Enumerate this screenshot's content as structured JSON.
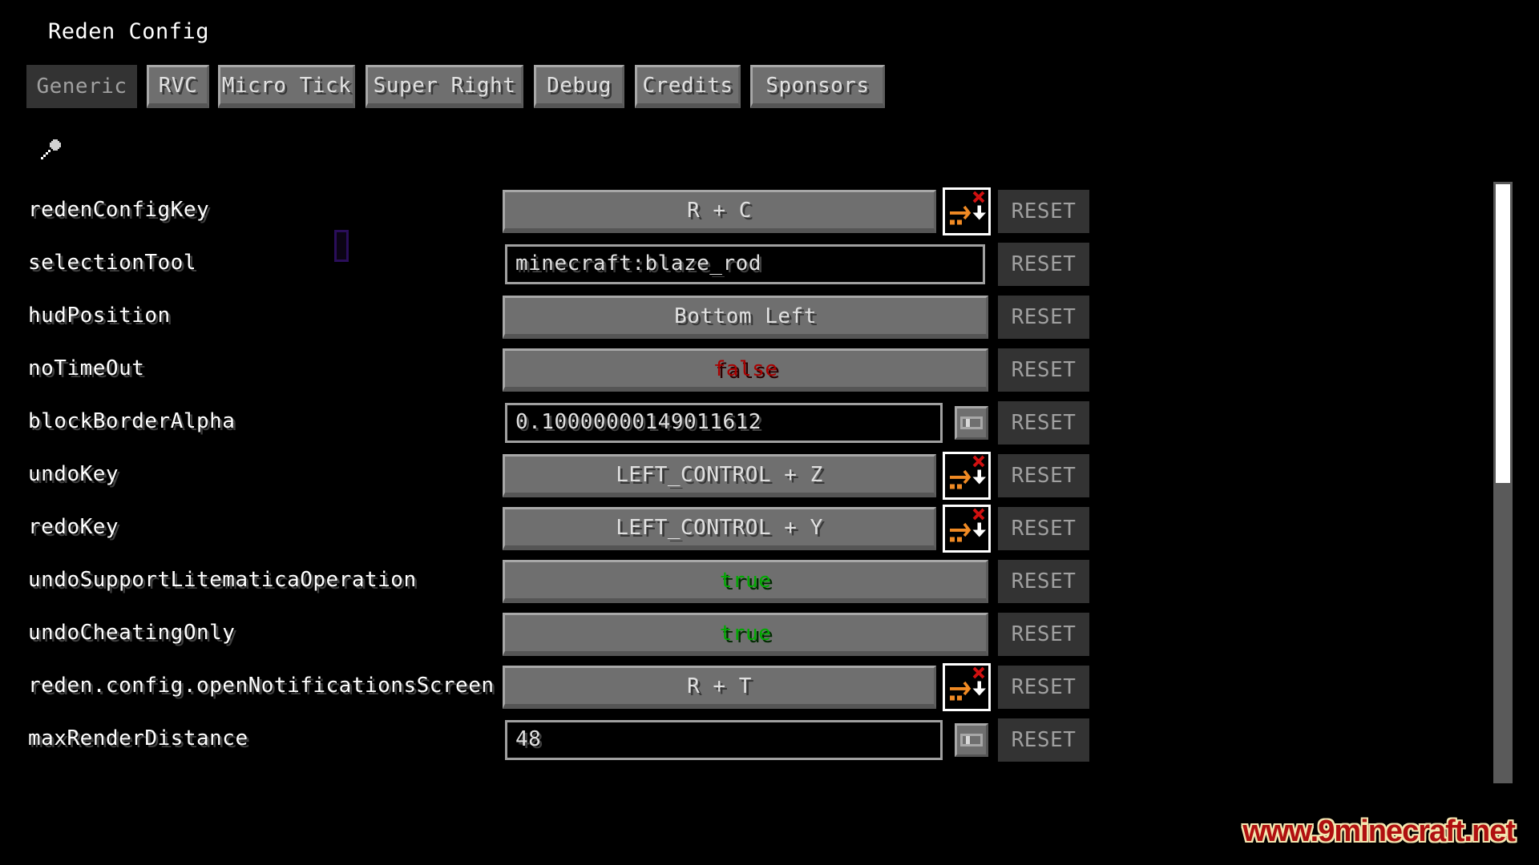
{
  "title": "Reden Config",
  "tabs": [
    {
      "label": "Generic",
      "active": true
    },
    {
      "label": "RVC",
      "active": false
    },
    {
      "label": "Micro Tick",
      "active": false
    },
    {
      "label": "Super Right",
      "active": false
    },
    {
      "label": "Debug",
      "active": false
    },
    {
      "label": "Credits",
      "active": false
    },
    {
      "label": "Sponsors",
      "active": false
    }
  ],
  "search": {
    "icon": "search-icon"
  },
  "reset_label": "RESET",
  "configs": [
    {
      "name": "redenConfigKey",
      "type": "hotkey",
      "value": "R + C"
    },
    {
      "name": "selectionTool",
      "type": "string",
      "value": "minecraft:blaze_rod"
    },
    {
      "name": "hudPosition",
      "type": "option",
      "value": "Bottom Left"
    },
    {
      "name": "noTimeOut",
      "type": "boolean",
      "value": "false"
    },
    {
      "name": "blockBorderAlpha",
      "type": "number",
      "value": "0.10000000149011612"
    },
    {
      "name": "undoKey",
      "type": "hotkey",
      "value": "LEFT_CONTROL + Z"
    },
    {
      "name": "redoKey",
      "type": "hotkey",
      "value": "LEFT_CONTROL + Y"
    },
    {
      "name": "undoSupportLitematicaOperation",
      "type": "boolean",
      "value": "true"
    },
    {
      "name": "undoCheatingOnly",
      "type": "boolean",
      "value": "true"
    },
    {
      "name": "reden.config.openNotificationsScreen",
      "type": "hotkey",
      "value": "R + T"
    },
    {
      "name": "maxRenderDistance",
      "type": "number",
      "value": "48"
    }
  ],
  "scrollbar": {
    "visible_fraction": 0.5,
    "position": 0.0
  },
  "colors": {
    "true": "#00aa00",
    "false": "#aa0000",
    "keybind_arrow": "#f08a24",
    "keybind_x": "#d01010"
  },
  "watermark": "www.9minecraft.net"
}
